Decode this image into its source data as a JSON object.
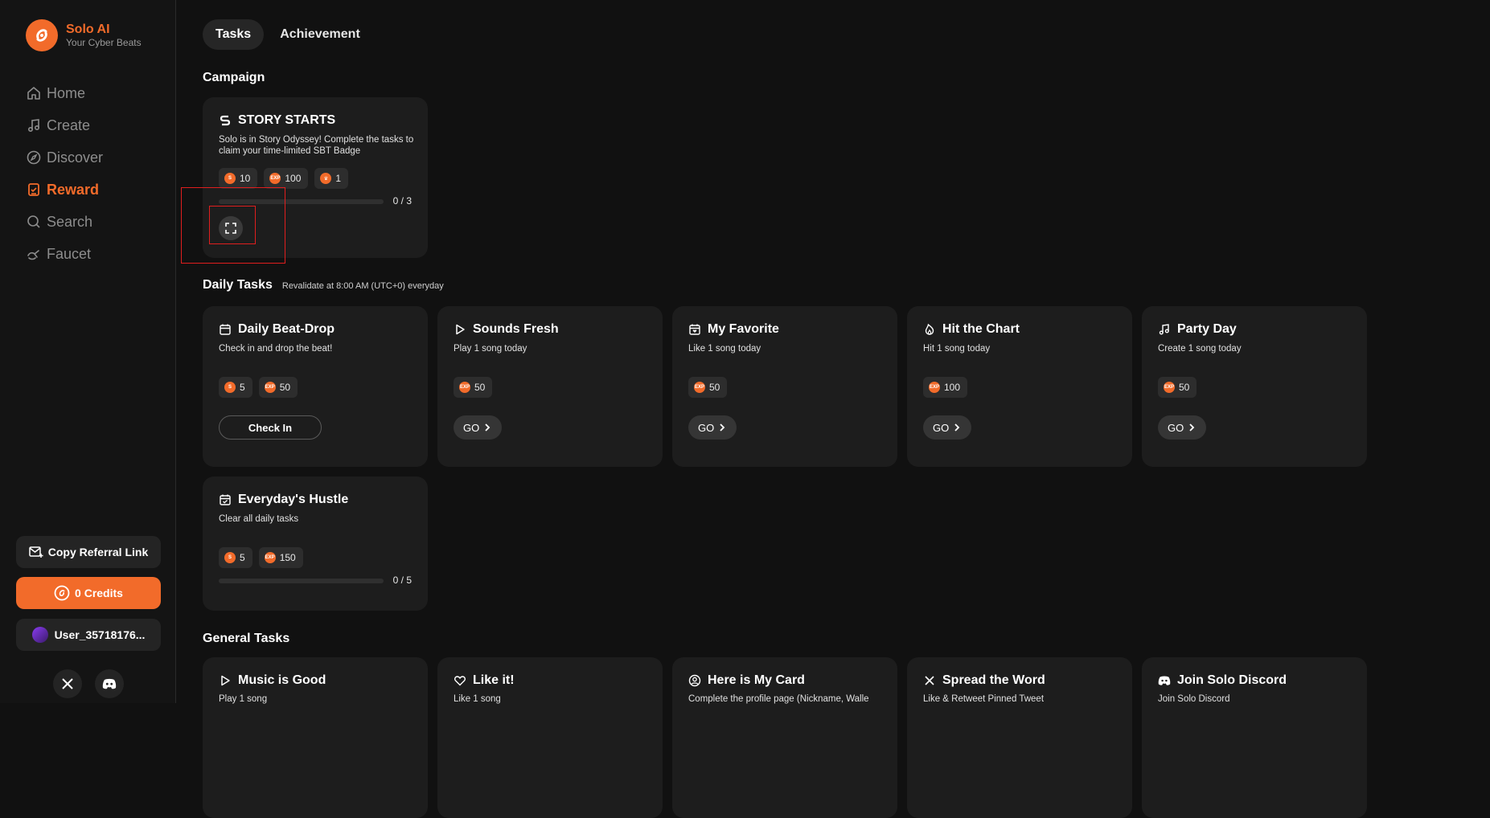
{
  "brand": {
    "name": "Solo AI",
    "tagline": "Your Cyber Beats"
  },
  "nav": [
    {
      "label": "Home",
      "icon": "home-icon"
    },
    {
      "label": "Create",
      "icon": "music-note-icon"
    },
    {
      "label": "Discover",
      "icon": "compass-icon"
    },
    {
      "label": "Reward",
      "icon": "reward-icon",
      "active": true
    },
    {
      "label": "Search",
      "icon": "search-icon"
    },
    {
      "label": "Faucet",
      "icon": "faucet-icon"
    }
  ],
  "sidebar_buttons": {
    "referral": "Copy Referral Link",
    "credits": "0 Credits",
    "user": "User_35718176..."
  },
  "tabs": {
    "tasks": "Tasks",
    "achievement": "Achievement"
  },
  "campaign": {
    "title": "Campaign",
    "card": {
      "name": "STORY STARTS",
      "desc": "Solo is in Story Odyssey! Complete the tasks to claim your time-limited SBT Badge",
      "rewards": [
        "10",
        "100",
        "1"
      ],
      "progress_text": "0 / 3",
      "progress": 0
    }
  },
  "daily": {
    "title": "Daily Tasks",
    "subtitle": "Revalidate at 8:00 AM (UTC+0) everyday",
    "cards": [
      {
        "name": "Daily Beat-Drop",
        "desc": "Check in and drop the beat!",
        "credit": "5",
        "exp": "50",
        "action": "Check In"
      },
      {
        "name": "Sounds Fresh",
        "desc": "Play 1 song today",
        "exp": "50",
        "action": "GO"
      },
      {
        "name": "My Favorite",
        "desc": "Like 1 song today",
        "exp": "50",
        "action": "GO"
      },
      {
        "name": "Hit the Chart",
        "desc": "Hit 1 song today",
        "exp": "100",
        "action": "GO"
      },
      {
        "name": "Party Day",
        "desc": "Create 1 song today",
        "exp": "50",
        "action": "GO"
      },
      {
        "name": "Everyday's Hustle",
        "desc": "Clear all daily tasks",
        "credit": "5",
        "exp": "150",
        "progress_text": "0 / 5",
        "progress": 0
      }
    ]
  },
  "general": {
    "title": "General Tasks",
    "cards": [
      {
        "name": "Music is Good",
        "desc": "Play 1 song"
      },
      {
        "name": "Like it!",
        "desc": "Like 1 song"
      },
      {
        "name": "Here is My Card",
        "desc": "Complete the profile page (Nickname, Walle"
      },
      {
        "name": "Spread the Word",
        "desc": "Like & Retweet Pinned Tweet"
      },
      {
        "name": "Join Solo Discord",
        "desc": "Join Solo Discord"
      }
    ]
  },
  "colors": {
    "accent": "#f26b2a",
    "background": "#111111",
    "card": "#1d1d1d",
    "highlight": "#e01e1e"
  }
}
